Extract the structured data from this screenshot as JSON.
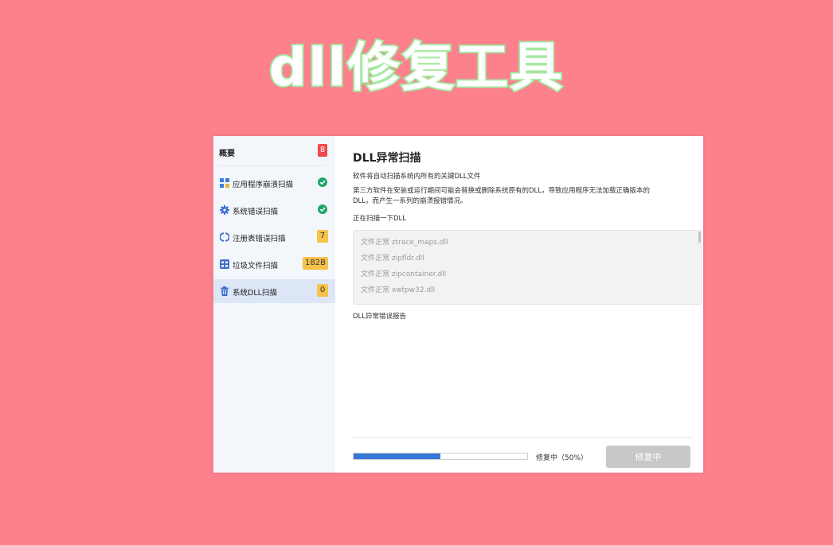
{
  "banner": {
    "title": "dll修复工具"
  },
  "sidebar": {
    "header": {
      "label": "概要",
      "badge": "8"
    },
    "items": [
      {
        "label": "应用程序崩溃扫描",
        "icon": "app-grid-icon",
        "status": "ok"
      },
      {
        "label": "系统错误扫描",
        "icon": "gear-icon",
        "status": "ok"
      },
      {
        "label": "注册表错误扫描",
        "icon": "refresh-ring-icon",
        "count": "7"
      },
      {
        "label": "垃圾文件扫描",
        "icon": "storage-grid-icon",
        "count": "182B"
      },
      {
        "label": "系统DLL扫描",
        "icon": "trash-icon",
        "count": "0",
        "active": true
      }
    ]
  },
  "main": {
    "title": "DLL异常扫描",
    "desc1": "软件将自动扫描系统内所有的关键DLL文件",
    "desc2": "第三方软件在安装或运行期间可能会替换或删除系统原有的DLL，导致应用程序无法加载正确版本的",
    "desc3": "DLL，而产生一系列的崩溃报错情况。",
    "scanning_label": "正在扫描一下DLL",
    "scan_lines": [
      "文件正常 ztrace_maps.dll",
      "文件正常 zipfldr.dll",
      "文件正常 zipcontainer.dll",
      "文件正常 xwtpw32.dll"
    ],
    "report_label": "DLL异常错误报告",
    "progress_label": "修复中（50%）",
    "progress_value": 0.5,
    "repair_button": "修复中"
  },
  "colors": {
    "background": "#fc818d",
    "accent": "#3778d8",
    "ok_green": "#23a56a",
    "badge_red": "#ef4a4a",
    "badge_yellow": "#f6c24a"
  }
}
